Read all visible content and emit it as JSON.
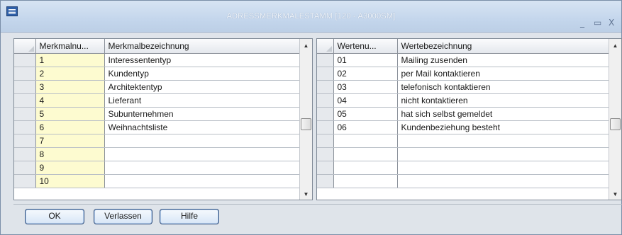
{
  "window": {
    "title": "ADRESSMERKMALESTAMM  [120 - A3000SM]",
    "controls": {
      "minimize": "_",
      "maximize": "▭",
      "close": "X"
    }
  },
  "left_grid": {
    "headers": [
      "Merkmalnu...",
      "Merkmalbezeichnung"
    ],
    "rows": [
      [
        "1",
        "Interessententyp"
      ],
      [
        "2",
        "Kundentyp"
      ],
      [
        "3",
        "Architektentyp"
      ],
      [
        "4",
        "Lieferant"
      ],
      [
        "5",
        "Subunternehmen"
      ],
      [
        "6",
        "Weihnachtsliste"
      ],
      [
        "7",
        ""
      ],
      [
        "8",
        ""
      ],
      [
        "9",
        ""
      ],
      [
        "10",
        ""
      ]
    ]
  },
  "right_grid": {
    "headers": [
      "Wertenu...",
      "Wertebezeichnung"
    ],
    "rows": [
      [
        "01",
        "Mailing zusenden"
      ],
      [
        "02",
        "per Mail kontaktieren"
      ],
      [
        "03",
        "telefonisch kontaktieren"
      ],
      [
        "04",
        "nicht kontaktieren"
      ],
      [
        "05",
        "hat sich selbst gemeldet"
      ],
      [
        "06",
        "Kundenbeziehung besteht"
      ],
      [
        "",
        ""
      ],
      [
        "",
        ""
      ],
      [
        "",
        ""
      ],
      [
        "",
        ""
      ]
    ]
  },
  "buttons": {
    "ok": "OK",
    "exit": "Verlassen",
    "help": "Hilfe"
  },
  "colors": {
    "key_column": "#fdfbd0",
    "button_border": "#2e4c7a",
    "titlebar": "#c4d6ec"
  }
}
